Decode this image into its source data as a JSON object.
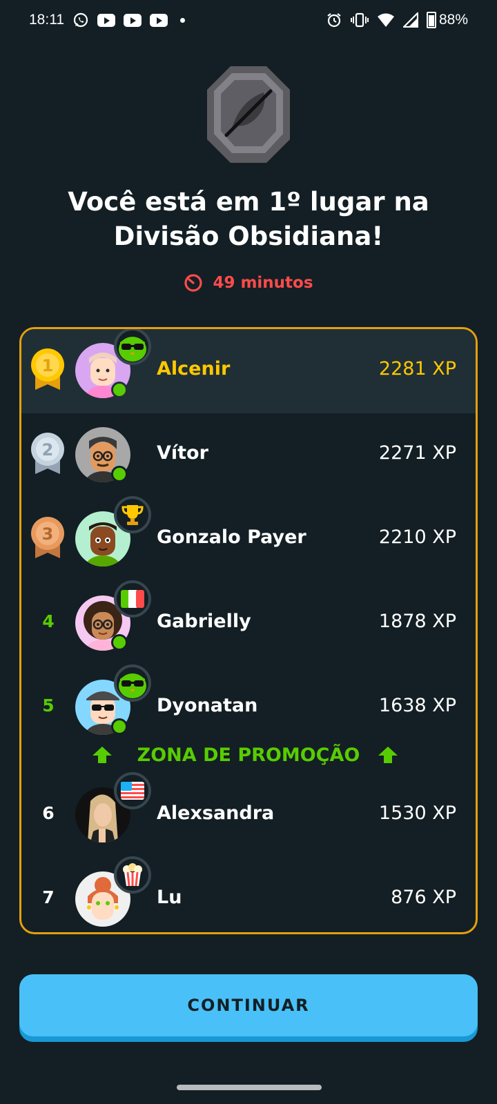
{
  "status_bar": {
    "time": "18:11",
    "battery": "88%",
    "left_icons": [
      "whatsapp-icon",
      "youtube-icon",
      "youtube-icon",
      "youtube-icon",
      "dot"
    ],
    "right_icons": [
      "alarm-icon",
      "vibrate-icon",
      "wifi-icon",
      "signal-icon",
      "battery-icon"
    ]
  },
  "header": {
    "title": "Você está em 1º lugar na Divisão Obsidiana!",
    "timer": "49 minutos",
    "badge_icon": "obsidian-league-badge-icon"
  },
  "leaderboard": {
    "rows": [
      {
        "rank": "1",
        "name": "Alcenir",
        "xp": "2281 XP",
        "medal": "gold",
        "online": true,
        "flair": "sunglasses-owl-icon",
        "avatar_color": "#d9a6f2"
      },
      {
        "rank": "2",
        "name": "Vítor",
        "xp": "2271 XP",
        "medal": "silver",
        "online": true,
        "flair": "",
        "avatar_color": "#a8a8a8"
      },
      {
        "rank": "3",
        "name": "Gonzalo Payer",
        "xp": "2210 XP",
        "medal": "bronze",
        "online": false,
        "flair": "trophy-icon",
        "avatar_color": "#b4f0d0"
      },
      {
        "rank": "4",
        "name": "Gabrielly",
        "xp": "1878 XP",
        "medal": "",
        "online": true,
        "flair": "italy-flag-icon",
        "avatar_color": "#f5c9f2"
      },
      {
        "rank": "5",
        "name": "Dyonatan",
        "xp": "1638 XP",
        "medal": "",
        "online": true,
        "flair": "sunglasses-owl-icon",
        "avatar_color": "#84d8ff"
      },
      {
        "rank": "6",
        "name": "Alexsandra",
        "xp": "1530 XP",
        "medal": "",
        "online": false,
        "flair": "usa-flag-icon",
        "avatar_color": "#111111"
      },
      {
        "rank": "7",
        "name": "Lu",
        "xp": "876 XP",
        "medal": "",
        "online": false,
        "flair": "popcorn-icon",
        "avatar_color": "#f0f0f0"
      }
    ],
    "promotion_zone_label": "ZONA DE PROMOÇÃO"
  },
  "continue_button": "CONTINUAR",
  "colors": {
    "background": "#131f24",
    "gold": "#ffc800",
    "border": "#e5a00d",
    "green": "#58cc02",
    "red": "#ff4b4b",
    "button": "#49c0f8"
  }
}
